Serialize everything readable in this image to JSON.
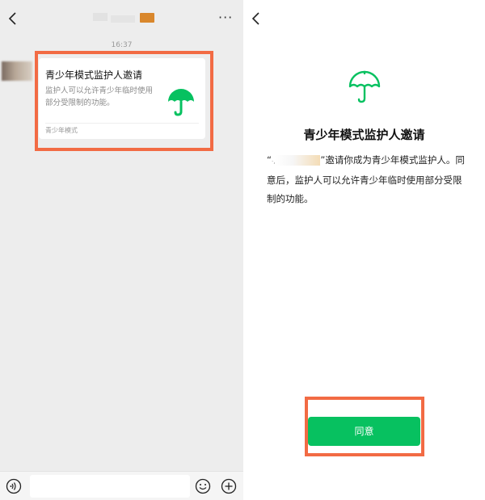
{
  "chat": {
    "timestamp": "16:37",
    "card": {
      "title": "青少年模式监护人邀请",
      "description": "监护人可以允许青少年临时使用部分受限制的功能。",
      "footer": "青少年模式"
    },
    "header": {
      "more_label": "···"
    }
  },
  "invite": {
    "title": "青少年模式监护人邀请",
    "quote_open": "“",
    "quote_mark": "·,",
    "description_rest": "”邀请你成为青少年模式监护人。同意后，监护人可以允许青少年临时使用部分受限制的功能。",
    "agree_label": "同意"
  },
  "colors": {
    "accent_green": "#07c160",
    "highlight_orange": "#f26b44",
    "chat_background": "#ededed"
  },
  "icons": [
    "back-arrow",
    "more-dots",
    "umbrella",
    "voice",
    "emoji",
    "add"
  ]
}
